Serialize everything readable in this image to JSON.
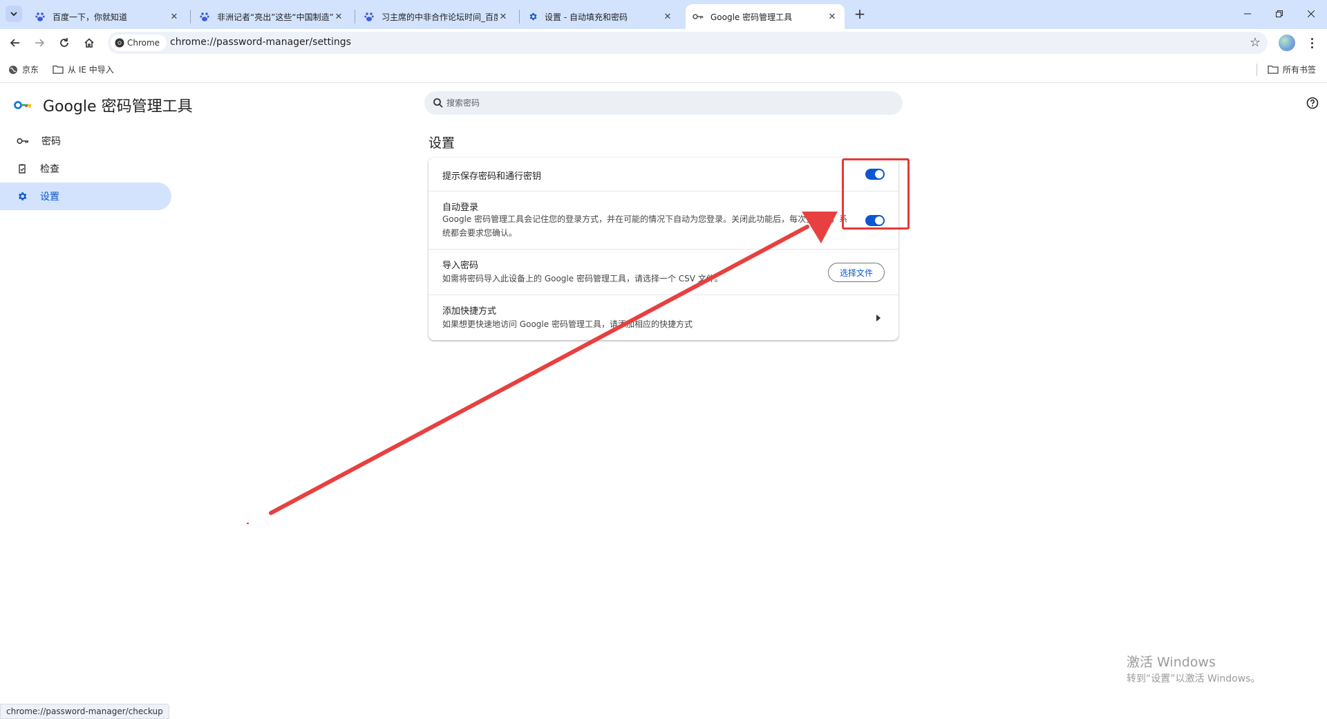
{
  "colors": {
    "accent": "#0b57d0",
    "annotation": "#e53935",
    "tabstrip": "#d3e3fd"
  },
  "tabs": [
    {
      "title": "百度一下，你就知道",
      "icon": "baidu-paw-icon"
    },
    {
      "title": "非洲记者“亮出”这些“中国制造”",
      "icon": "baidu-paw-icon"
    },
    {
      "title": "习主席的中非合作论坛时间_百度",
      "icon": "baidu-paw-icon"
    },
    {
      "title": "设置 - 自动填充和密码",
      "icon": "gear-icon"
    },
    {
      "title": "Google 密码管理工具",
      "icon": "key-icon",
      "active": true
    }
  ],
  "toolbar": {
    "chip_label": "Chrome",
    "url": "chrome://password-manager/settings"
  },
  "bookmarks": {
    "items": [
      "京东",
      "从 IE 中导入"
    ],
    "all_bookmarks": "所有书签"
  },
  "brand": {
    "title": "Google 密码管理工具"
  },
  "sidebar": {
    "items": [
      {
        "label": "密码",
        "icon": "key-icon"
      },
      {
        "label": "检查",
        "icon": "checkup-icon"
      },
      {
        "label": "设置",
        "icon": "gear-icon",
        "active": true
      }
    ]
  },
  "search": {
    "placeholder": "搜索密码"
  },
  "settings": {
    "title": "设置",
    "rows": [
      {
        "title": "提示保存密码和通行密钥",
        "control": "toggle",
        "on": true
      },
      {
        "title": "自动登录",
        "desc": "Google 密码管理工具会记住您的登录方式，并在可能的情况下自动为您登录。关闭此功能后，每次登录时，系统都会要求您确认。",
        "control": "toggle",
        "on": true
      },
      {
        "title": "导入密码",
        "desc": "如需将密码导入此设备上的 Google 密码管理工具，请选择一个 CSV 文件。",
        "control": "button",
        "button_label": "选择文件"
      },
      {
        "title": "添加快捷方式",
        "desc": "如果想更快速地访问 Google 密码管理工具，请添加相应的快捷方式",
        "control": "chevron"
      }
    ]
  },
  "watermark": {
    "title": "激活 Windows",
    "subtitle": "转到“设置”以激活 Windows。"
  },
  "status_url": "chrome://password-manager/checkup"
}
